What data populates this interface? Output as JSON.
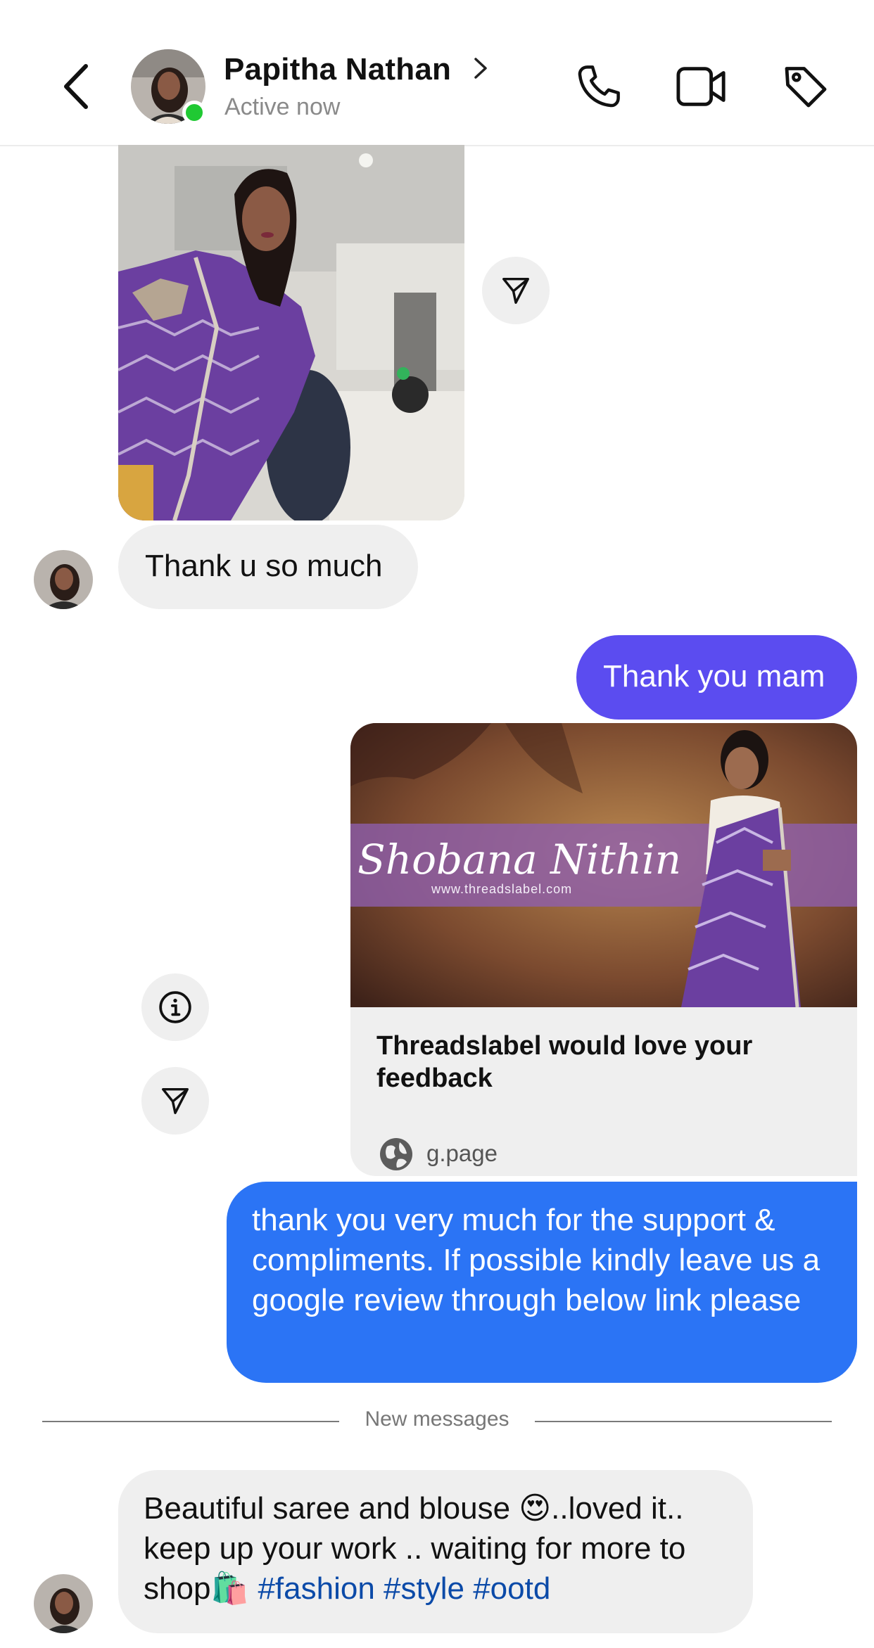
{
  "header": {
    "contact_name": "Papitha Nathan",
    "status": "Active now",
    "icons": [
      "back-chevron-icon",
      "chevron-right-icon",
      "phone-icon",
      "video-camera-icon",
      "tag-icon"
    ]
  },
  "messages": {
    "received_1": "Thank u so much",
    "sent_1": "Thank you mam",
    "link_card": {
      "banner_brand": "Shobana Nithin",
      "banner_url": "www.threadslabel.com",
      "title": "Threadslabel would love your feedback",
      "domain": "g.page"
    },
    "sent_2": "thank you very much for the support & compliments. If possible kindly leave us a google review through below link please",
    "divider": "New messages",
    "received_2": {
      "text_before_emoji": "Beautiful saree and blouse ",
      "emoji_1": "😍",
      "text_after_emoji": "..loved it.. keep up your work .. waiting for more to shop",
      "emoji_2": "🛍️",
      "hashtags": "#fashion #style #ootd"
    }
  },
  "colors": {
    "sent_bubble_purple": "#5b4cf0",
    "sent_bubble_blue": "#2b74f5",
    "received_bubble": "#efefef",
    "online_dot": "#20c933",
    "hashtag": "#0b4aa8",
    "saree_purple": "#6b3fa0"
  }
}
